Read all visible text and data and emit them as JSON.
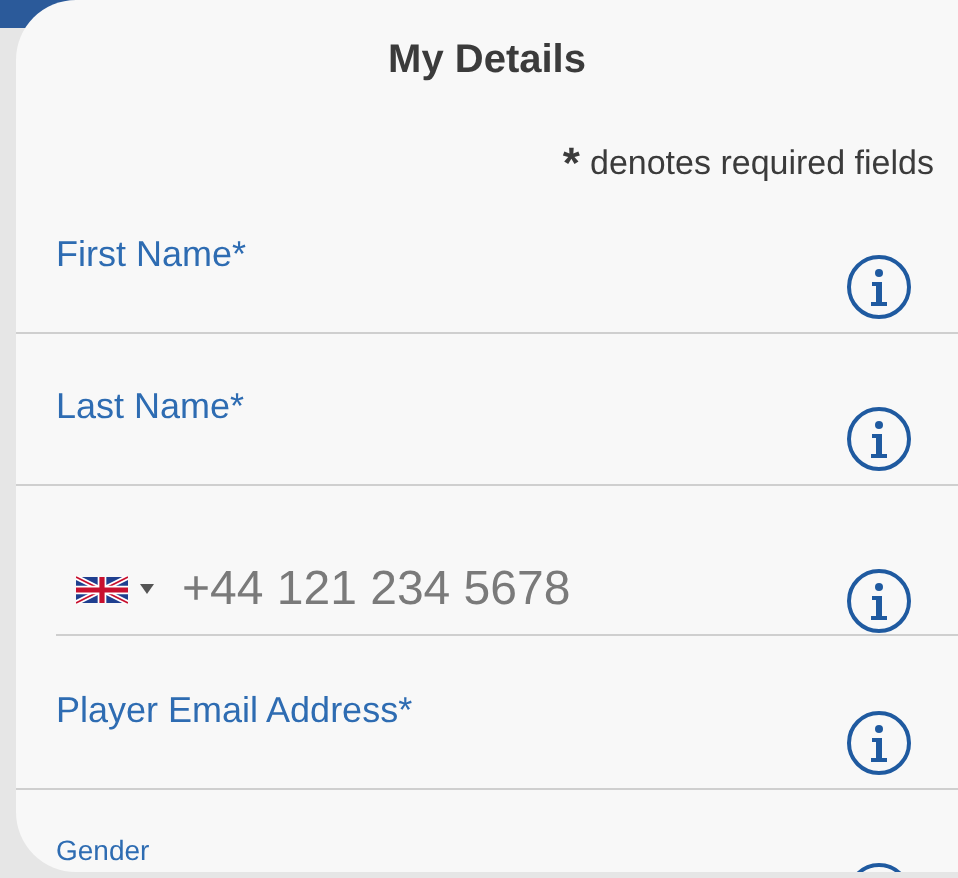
{
  "dialog": {
    "title": "My Details",
    "required_note": {
      "mark": "*",
      "text": "denotes required fields"
    }
  },
  "fields": [
    {
      "kind": "text",
      "label": "First Name*"
    },
    {
      "kind": "text",
      "label": "Last Name*"
    },
    {
      "kind": "phone",
      "placeholder": "+44 121 234 5678"
    },
    {
      "kind": "text",
      "label": "Player Email Address*"
    },
    {
      "kind": "select",
      "label": "Gender"
    }
  ]
}
